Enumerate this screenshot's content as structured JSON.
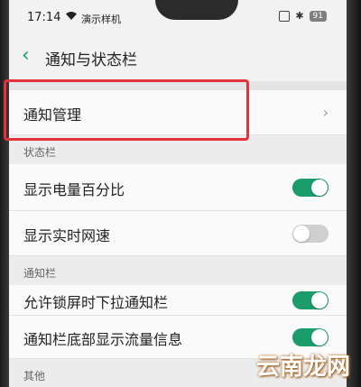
{
  "status_bar": {
    "time": "17:14",
    "carrier": "演示样机",
    "battery": "91"
  },
  "header": {
    "title": "通知与状态栏"
  },
  "rows": {
    "notification_management": {
      "label": "通知管理"
    }
  },
  "sections": {
    "status_bar": {
      "label": "状态栏"
    },
    "notification_bar": {
      "label": "通知栏"
    },
    "other": {
      "label": "其他"
    }
  },
  "settings": {
    "battery_percent": {
      "label": "显示电量百分比",
      "enabled": true
    },
    "realtime_speed": {
      "label": "显示实时网速",
      "enabled": false
    },
    "lockscreen_pulldown": {
      "label": "允许锁屏时下拉通知栏",
      "enabled": true
    },
    "traffic_info": {
      "label": "通知栏底部显示流量信息",
      "enabled": true
    }
  },
  "watermark": "云南龙网",
  "colors": {
    "accent": "#1a9d6b",
    "highlight": "#e5313b"
  }
}
